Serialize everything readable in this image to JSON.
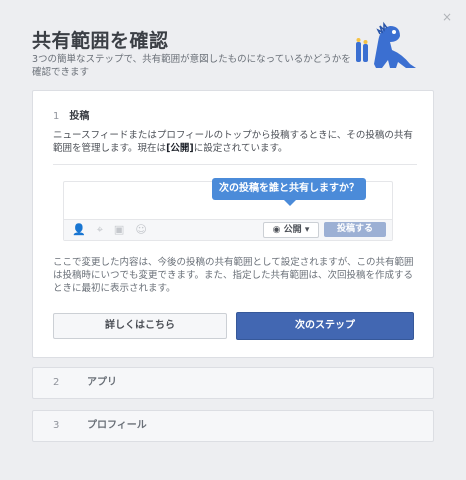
{
  "dialog": {
    "title": "共有範囲を確認",
    "subtitle": "3つの簡単なステップで、共有範囲が意図したものになっているかどうかを確認できます",
    "close": "×"
  },
  "step1": {
    "num": "1",
    "label": "投稿",
    "desc_pre": "ニュースフィードまたはプロフィールのトップから投稿するときに、その投稿の共有範囲を管理します。現在は",
    "desc_bold": "[公開]",
    "desc_post": "に設定されています。",
    "tooltip": "次の投稿を誰と共有しますか？",
    "audience": "公開",
    "post_button": "投稿する",
    "note": "ここで変更した内容は、今後の投稿の共有範囲として設定されますが、この共有範囲は投稿時にいつでも変更できます。また、指定した共有範囲は、次回投稿を作成するときに最初に表示されます。",
    "more_button": "詳しくはこちら",
    "next_button": "次のステップ"
  },
  "step2": {
    "num": "2",
    "label": "アプリ"
  },
  "step3": {
    "num": "3",
    "label": "プロフィール"
  },
  "colors": {
    "primary": "#4267b2",
    "tooltip": "#4b8bd9",
    "mascot": "#3b6fd1"
  }
}
